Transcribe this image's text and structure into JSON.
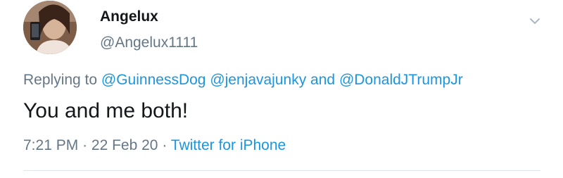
{
  "author": {
    "display_name": "Angelux",
    "handle": "@Angelux1111"
  },
  "reply": {
    "prefix": "Replying to",
    "mentions": [
      "@GuinnessDog",
      "@jenjavajunky"
    ],
    "conjunction": "and",
    "last_mention": "@DonaldJTrumpJr"
  },
  "tweet": {
    "text": "You and me both!"
  },
  "meta": {
    "time": "7:21 PM",
    "separator": "·",
    "date": "22 Feb 20",
    "source": "Twitter for iPhone"
  },
  "colors": {
    "link": "#1b95e0",
    "secondary_text": "#657786",
    "primary_text": "#14171a",
    "divider": "#e1e8ed"
  },
  "icons": {
    "menu": "chevron-down-icon"
  }
}
